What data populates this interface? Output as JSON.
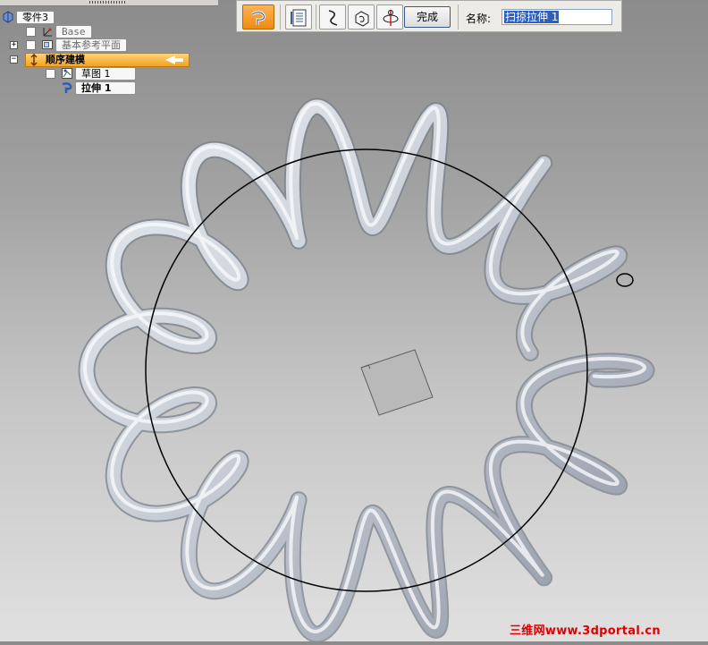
{
  "tree": {
    "root_label": "零件3",
    "base_label": "Base",
    "ref_planes_label": "基本参考平面",
    "ordered_label": "顺序建模",
    "sketch_label": "草图 1",
    "extrude_label": "拉伸 1",
    "expand_glyph": "+",
    "collapse_glyph": "−"
  },
  "command_bar": {
    "finish_label": "完成",
    "name_label": "名称:",
    "name_value": "扫掠拉伸 1"
  },
  "icons": {
    "part": "part-icon",
    "base_cs": "coordinate-system-icon",
    "ref_plane": "reference-plane-icon",
    "ordered": "ordered-modeling-icon",
    "sketch": "sketch-icon",
    "extrude": "extrude-icon",
    "sweep_step": "sweep-step-icon",
    "sheet": "sheet-settings-icon",
    "path": "path-step-icon",
    "cross_section": "cross-section-step-icon",
    "orientation": "orientation-step-icon"
  },
  "colors": {
    "accent_orange": "#f4a21c",
    "spring_metal": "#c7ccd4",
    "watermark_red": "#e00000"
  },
  "watermark": "三维网www.3dportal.cn"
}
